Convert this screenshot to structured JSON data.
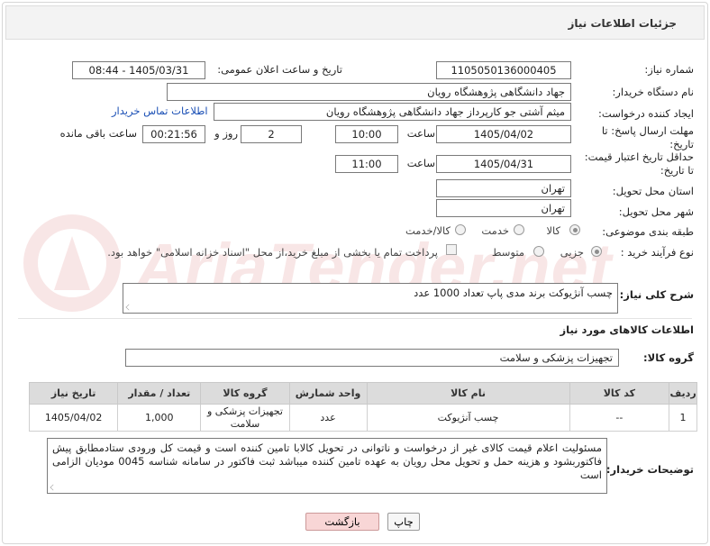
{
  "title": "جزئیات اطلاعات نیاز",
  "labels": {
    "need_number": "شماره نیاز:",
    "announce_datetime": "تاریخ و ساعت اعلان عمومی:",
    "buyer_org": "نام دستگاه خریدار:",
    "requester": "ایجاد کننده درخواست:",
    "reply_deadline": "مهلت ارسال پاسخ: تا تاریخ:",
    "price_validity": "حداقل تاریخ اعتبار قیمت: تا تاریخ:",
    "time": "ساعت",
    "days_and": "روز و",
    "remaining": "ساعت باقی مانده",
    "delivery_province": "استان محل تحویل:",
    "delivery_city": "شهر محل تحویل:",
    "category": "طبقه بندی موضوعی:",
    "purchase_type": "نوع فرآیند خرید :",
    "need_description": "شرح کلی نیاز:",
    "goods_info": "اطلاعات کالاهای مورد نیاز",
    "goods_group": "گروه کالا:",
    "buyer_notes": "توضیحات خریدار:"
  },
  "values": {
    "need_number": "1105050136000405",
    "announce_datetime": "1405/03/31 - 08:44",
    "buyer_org": "جهاد دانشگاهی پژوهشگاه رویان",
    "requester": "میثم  آشتی جو کارپرداز جهاد دانشگاهی پژوهشگاه رویان",
    "contact_link": "اطلاعات تماس خریدار",
    "reply_date": "1405/04/02",
    "reply_time": "10:00",
    "days": "2",
    "remaining_time": "00:21:56",
    "validity_date": "1405/04/31",
    "validity_time": "11:00",
    "province": "تهران",
    "city": "تهران",
    "need_description": "چسب آنژیوکت برند مدی پاپ تعداد 1000 عدد",
    "goods_group": "تجهیزات پزشکی و سلامت",
    "buyer_notes": "مسئولیت اعلام قیمت کالای غیر از درخواست و ناتوانی در تحویل کالابا تامین کننده است و قیمت کل ورودی ستادمطابق پیش فاکتوربشود و هزینه حمل و تحویل محل رویان به عهده تامین کننده میباشد ثبت فاکتور در سامانه شناسه 0045 مودیان الزامی است"
  },
  "category_options": [
    {
      "label": "کالا",
      "selected": true
    },
    {
      "label": "خدمت",
      "selected": false
    },
    {
      "label": "کالا/خدمت",
      "selected": false
    }
  ],
  "purchase_options": [
    {
      "label": "جزیی",
      "selected": true
    },
    {
      "label": "متوسط",
      "selected": false
    }
  ],
  "payment_note": "پرداخت تمام یا بخشی از مبلغ خرید،از محل \"اسناد خزانه اسلامی\" خواهد بود.",
  "table": {
    "headers": [
      "ردیف",
      "کد کالا",
      "نام کالا",
      "واحد شمارش",
      "گروه کالا",
      "تعداد / مقدار",
      "تاریخ نیاز"
    ],
    "rows": [
      [
        "1",
        "--",
        "چسب آنژیوکت",
        "عدد",
        "تجهیزات پزشکی و سلامت",
        "1,000",
        "1405/04/02"
      ]
    ]
  },
  "buttons": {
    "print": "چاپ",
    "back": "بازگشت"
  },
  "watermark": "AriaTender.net",
  "colors": {
    "link": "#1a4fb5",
    "header_bg": "#dcdcdc",
    "back_button": "#f8d6d6"
  }
}
